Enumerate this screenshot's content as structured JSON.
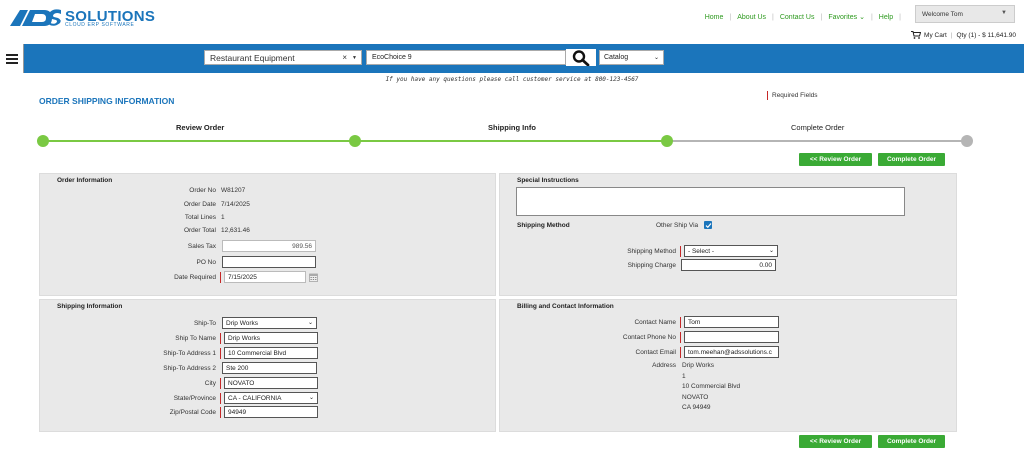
{
  "brand": {
    "name": "SOLUTIONS",
    "tagline": "CLOUD ERP SOFTWARE",
    "colors": {
      "primary_blue": "#1b75bb",
      "accent_green": "#3aaa35",
      "required_red": "#c62828"
    }
  },
  "topnav": {
    "links": [
      "Home",
      "About Us",
      "Contact Us",
      "Favorites",
      "Help"
    ],
    "welcome": "Welcome Tom",
    "cart": {
      "label": "My Cart",
      "summary": "Qty (1) - $ 11,641.90"
    }
  },
  "searchbar": {
    "category_value": "Restaurant Equipment",
    "search_value": "EcoChoice 9",
    "catalog_value": "Catalog",
    "icons": {
      "menu": "hamburger-icon",
      "search": "search-icon",
      "clear": "clear-icon"
    }
  },
  "notice": "If you have any questions please call customer service at 800-123-4567",
  "page": {
    "title": "ORDER SHIPPING INFORMATION",
    "required_label": "Required Fields"
  },
  "progress": {
    "steps": [
      {
        "label": "Review Order",
        "state": "done"
      },
      {
        "label": "Shipping Info",
        "state": "current"
      },
      {
        "label": "Complete Order",
        "state": "pending"
      }
    ],
    "colors": {
      "done": "#7ac943",
      "pending": "#b5b5b5"
    }
  },
  "actions": {
    "review_label": "<< Review Order",
    "complete_label": "Complete Order"
  },
  "order_info": {
    "title": "Order Information",
    "order_no_label": "Order No",
    "order_no": "W81207",
    "order_date_label": "Order Date",
    "order_date": "7/14/2025",
    "total_lines_label": "Total Lines",
    "total_lines": "1",
    "order_total_label": "Order Total",
    "order_total": "12,631.46",
    "sales_tax_label": "Sales Tax",
    "sales_tax": "989.56",
    "po_no_label": "PO No",
    "po_no": "",
    "date_required_label": "Date Required",
    "date_required": "7/15/2025"
  },
  "special": {
    "title": "Special Instructions",
    "instructions": "",
    "shipping_method_title": "Shipping Method",
    "other_ship_via_label": "Other Ship Via",
    "other_ship_via_checked": true,
    "shipping_method_label": "Shipping Method",
    "shipping_method_value": "- Select -",
    "shipping_charge_label": "Shipping Charge",
    "shipping_charge": "0.00"
  },
  "shipping": {
    "title": "Shipping Information",
    "ship_to_label": "Ship-To",
    "ship_to": "Drip Works",
    "ship_to_name_label": "Ship To Name",
    "ship_to_name": "Drip Works",
    "address1_label": "Ship-To Address 1",
    "address1": "10 Commercial Blvd",
    "address2_label": "Ship-To Address 2",
    "address2": "Ste 200",
    "city_label": "City",
    "city": "NOVATO",
    "state_label": "State/Province",
    "state": "CA - CALIFORNIA",
    "zip_label": "Zip/Postal Code",
    "zip": "94949"
  },
  "billing": {
    "title": "Billing and Contact Information",
    "contact_name_label": "Contact Name",
    "contact_name": "Tom",
    "contact_phone_label": "Contact Phone No",
    "contact_phone": "",
    "contact_email_label": "Contact Email",
    "contact_email": "tom.meehan@adssolutions.c",
    "address_label": "Address",
    "address_lines": [
      "Drip Works",
      "1",
      "10 Commercial Blvd",
      "NOVATO",
      "CA 94949"
    ]
  }
}
